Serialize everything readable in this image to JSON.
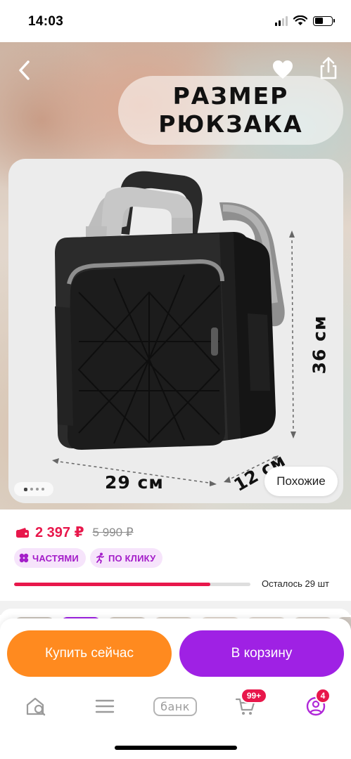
{
  "status_bar": {
    "time": "14:03"
  },
  "hero": {
    "title_line1": "РАЗМЕР",
    "title_line2": "РЮКЗАКА",
    "dim_width": "29 см",
    "dim_depth": "12 см",
    "dim_height": "36 см",
    "similar_label": "Похожие",
    "gallery_dots": 4,
    "gallery_active_index": 0
  },
  "product": {
    "price_now": "2 397 ₽",
    "price_old": "5 990 ₽",
    "tags": [
      {
        "label": "ЧАСТЯМИ",
        "icon": "split-payment-icon"
      },
      {
        "label": "ПО КЛИКУ",
        "icon": "running-person-icon"
      }
    ],
    "stock_fraction": 0.83,
    "stock_text": "Осталось 29 шт",
    "accent_color": "#e8174b"
  },
  "actions": {
    "buy_now_label": "Купить сейчас",
    "add_to_cart_label": "В корзину",
    "buy_color": "#ff8a1f",
    "cart_color": "#9f21e4"
  },
  "tabbar": {
    "bank_label": "банк",
    "cart_badge": "99+",
    "profile_badge": "4",
    "tabs": [
      "home-search-icon",
      "menu-icon",
      "bank-icon",
      "cart-icon",
      "profile-icon"
    ]
  }
}
